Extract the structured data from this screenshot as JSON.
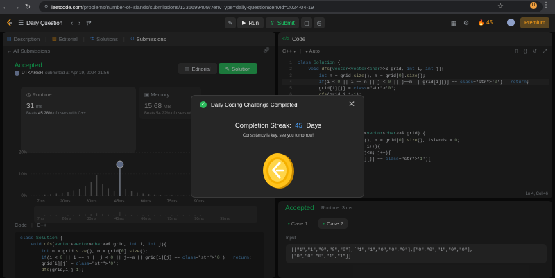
{
  "browser": {
    "url_host": "leetcode.com",
    "url_path": "/problems/number-of-islands/submissions/1236699409/?envType=daily-question&envId=2024-04-19",
    "ext_badge": "U"
  },
  "topbar": {
    "title": "Daily Question",
    "run_label": "Run",
    "submit_label": "Submit",
    "streak_count": "45",
    "premium_label": "Premium"
  },
  "left_tabs": [
    {
      "label": "Description"
    },
    {
      "label": "Editorial"
    },
    {
      "label": "Solutions"
    },
    {
      "label": "Submissions"
    }
  ],
  "submission": {
    "back_label": "All Submissions",
    "status": "Accepted",
    "user": "UTKARSH",
    "submitted_at": "submitted at Apr 19, 2024 21:56",
    "editorial_label": "Editorial",
    "solution_label": "Solution",
    "runtime_label": "Runtime",
    "runtime_value": "31",
    "runtime_unit": "ms",
    "runtime_beats_prefix": "Beats",
    "runtime_beats": "45.28%",
    "runtime_beats_suffix": "of users with C++",
    "memory_label": "Memory",
    "memory_value": "15.68",
    "memory_unit": "MB",
    "memory_beats_prefix": "Beats",
    "memory_beats": "54.22%",
    "memory_beats_suffix": "of users with C++",
    "code_label": "Code",
    "code_lang": "C++"
  },
  "chart_data": {
    "type": "bar",
    "yticks": [
      "20%",
      "10%",
      "0%"
    ],
    "xticks": [
      "7ms",
      "20ms",
      "30ms",
      "45ms",
      "60ms",
      "75ms",
      "90ms"
    ],
    "mini_xticks": [
      "7ms",
      "20ms",
      "30ms",
      "45ms",
      "60ms",
      "75ms",
      "90ms",
      "95ms"
    ],
    "ylim": [
      0,
      25
    ],
    "values": [
      0.4,
      0.6,
      0.8,
      1.0,
      1.6,
      2.4,
      3.2,
      4.4,
      6.2,
      9.4,
      5.2,
      3.4,
      2.0,
      12.8,
      3.2,
      2.0,
      1.4,
      0.8,
      0.6,
      0.4,
      0.3,
      0.2,
      0.2,
      0.15,
      0.1,
      0.1,
      0.1,
      0.1
    ],
    "highlight_index": 13,
    "bar_color": "#6b6b6b",
    "highlight_color": "#b8c4d8"
  },
  "left_code": [
    {
      "text": "class Solution {"
    },
    {
      "text": "    void dfs(vector<vector<char>>& grid, int i, int j){"
    },
    {
      "text": "        int n = grid.size(), m = grid[0].size();"
    },
    {
      "text": "        if(i < 0 || i == n || j < 0 || j==m || grid[i][j] == '0')   return;"
    },
    {
      "text": "        grid[i][j] = '0';"
    },
    {
      "text": "        dfs(grid,i,j-1);"
    }
  ],
  "editor": {
    "title": "Code",
    "lang": "C++",
    "mode": "Auto",
    "status": "Ln 4, Col 46",
    "lines": [
      {
        "n": "1",
        "text": "class Solution {"
      },
      {
        "n": "2",
        "text": "    void dfs(vector<vector<char>>& grid, int i, int j){"
      },
      {
        "n": "3",
        "text": "        int n = grid.size(), m = grid[0].size();"
      },
      {
        "n": "4",
        "text": "        if(i < 0 || i == n || j < 0 || j==m || grid[i][j] == '0')   return;"
      },
      {
        "n": "5",
        "text": "        grid[i][j] = '0';"
      },
      {
        "n": "6",
        "text": "        dfs(grid,i,j-1);"
      },
      {
        "n": "7",
        "text": "        dfs(grid,i,j+1);"
      },
      {
        "n": "8",
        "text": "        dfs(grid,i-1,j);"
      },
      {
        "n": "9",
        "text": "        dfs(grid,i+1,j);"
      },
      {
        "n": "10",
        "text": "    }"
      },
      {
        "n": "11",
        "text": "public:"
      },
      {
        "n": "12",
        "text": "    int numIslands(vector<vector<char>>& grid) {"
      },
      {
        "n": "13",
        "text": "        int n = grid.size(), m = grid[0].size(), islands = 0;"
      },
      {
        "n": "14",
        "text": "        for(int i=0; i<n; i++){"
      },
      {
        "n": "15",
        "text": "            for(int j=0; j<m; j++){"
      },
      {
        "n": "16",
        "text": "                if(grid[i][j] == '1'){"
      }
    ]
  },
  "result": {
    "status": "Accepted",
    "runtime": "Runtime: 3 ms",
    "case1": "Case 1",
    "case2": "Case 2",
    "input_label": "Input",
    "input_line1": "[[\"1\",\"1\",\"0\",\"0\",\"0\"],[\"1\",\"1\",\"0\",\"0\",\"0\"],[\"0\",\"0\",\"1\",\"0\",\"0\"],",
    "input_line2": "[\"0\",\"0\",\"0\",\"1\",\"1\"]]"
  },
  "modal": {
    "title": "Daily Coding Challenge Completed!",
    "streak_label": "Completion Streak:",
    "streak_value": "45",
    "streak_unit": "Days",
    "message": "Consistency is key, see you tomorrow!"
  }
}
